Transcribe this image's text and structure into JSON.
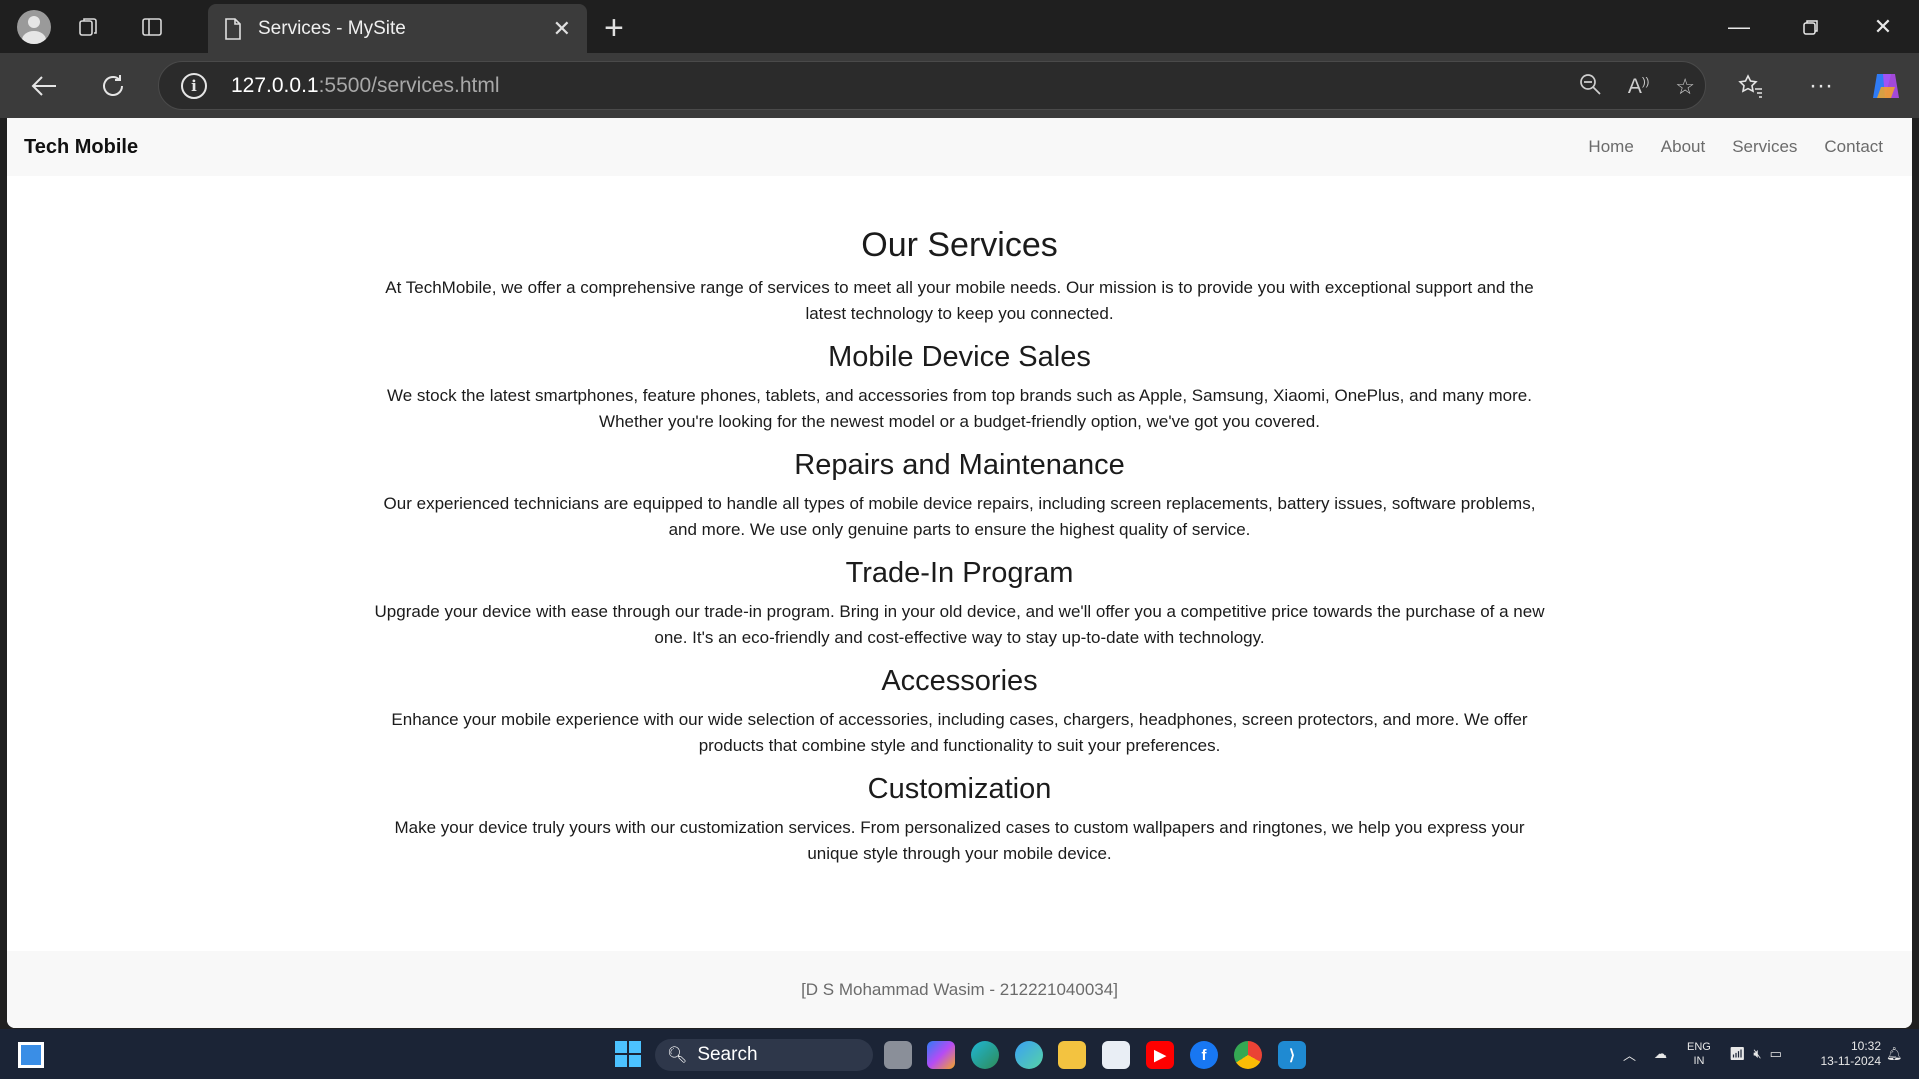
{
  "browser": {
    "tab_title": "Services - MySite",
    "url_host": "127.0.0.1",
    "url_path": ":5500/services.html"
  },
  "site": {
    "brand": "Tech Mobile",
    "nav": [
      "Home",
      "About",
      "Services",
      "Contact"
    ]
  },
  "page": {
    "heading": "Our Services",
    "intro": "At TechMobile, we offer a comprehensive range of services to meet all your mobile needs. Our mission is to provide you with exceptional support and the latest technology to keep you connected.",
    "sections": [
      {
        "title": "Mobile Device Sales",
        "text": "We stock the latest smartphones, feature phones, tablets, and accessories from top brands such as Apple, Samsung, Xiaomi, OnePlus, and many more. Whether you're looking for the newest model or a budget-friendly option, we've got you covered."
      },
      {
        "title": "Repairs and Maintenance",
        "text": "Our experienced technicians are equipped to handle all types of mobile device repairs, including screen replacements, battery issues, software problems, and more. We use only genuine parts to ensure the highest quality of service."
      },
      {
        "title": "Trade-In Program",
        "text": "Upgrade your device with ease through our trade-in program. Bring in your old device, and we'll offer you a competitive price towards the purchase of a new one. It's an eco-friendly and cost-effective way to stay up-to-date with technology."
      },
      {
        "title": "Accessories",
        "text": "Enhance your mobile experience with our wide selection of accessories, including cases, chargers, headphones, screen protectors, and more. We offer products that combine style and functionality to suit your preferences."
      },
      {
        "title": "Customization",
        "text": "Make your device truly yours with our customization services. From personalized cases to custom wallpapers and ringtones, we help you express your unique style through your mobile device."
      }
    ],
    "footer": "[D S Mohammad Wasim - 212221040034]"
  },
  "taskbar": {
    "search_label": "Search",
    "lang_top": "ENG",
    "lang_bottom": "IN",
    "time": "10:32",
    "date": "13-11-2024"
  },
  "colors": {
    "accent": "#4cc2ff",
    "page_bg": "#ffffff",
    "nav_bg": "#f8f8f8"
  }
}
